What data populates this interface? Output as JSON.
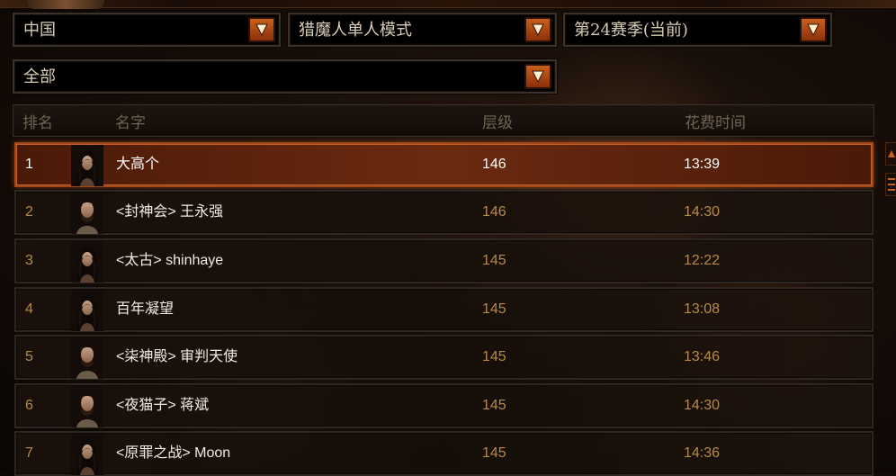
{
  "filters": {
    "region": "中国",
    "class_mode": "猎魔人单人模式",
    "season": "第24赛季(当前)",
    "category": "全部"
  },
  "columns": {
    "rank": "排名",
    "name": "名字",
    "tier": "层级",
    "time": "花费时间"
  },
  "rows": [
    {
      "rank": "1",
      "name": "大高个",
      "tier": "146",
      "time": "13:39",
      "portrait": "female-hero-portrait"
    },
    {
      "rank": "2",
      "name": "<封神会> 王永强",
      "tier": "146",
      "time": "14:30",
      "portrait": "male-hero-portrait"
    },
    {
      "rank": "3",
      "name": "<太古> shinhaye",
      "tier": "145",
      "time": "12:22",
      "portrait": "female-hero-portrait"
    },
    {
      "rank": "4",
      "name": "百年凝望",
      "tier": "145",
      "time": "13:08",
      "portrait": "female-hero-portrait"
    },
    {
      "rank": "5",
      "name": "<柒神殿> 审判天使",
      "tier": "145",
      "time": "13:46",
      "portrait": "male-hero-portrait"
    },
    {
      "rank": "6",
      "name": "<夜猫子> 蒋斌",
      "tier": "145",
      "time": "14:30",
      "portrait": "male-hero-portrait"
    },
    {
      "rank": "7",
      "name": "<原罪之战> Moon",
      "tier": "145",
      "time": "14:36",
      "portrait": "female-hero-portrait"
    }
  ],
  "colors": {
    "accent": "#c8601c",
    "selected_row": "#6b2a10",
    "rank_text": "#b88a48",
    "name_text": "#f0ece4"
  },
  "icons": {
    "dropdown": "chevron-down-icon",
    "scroll_up": "scroll-up-icon",
    "scroll_down": "scroll-down-icon"
  }
}
